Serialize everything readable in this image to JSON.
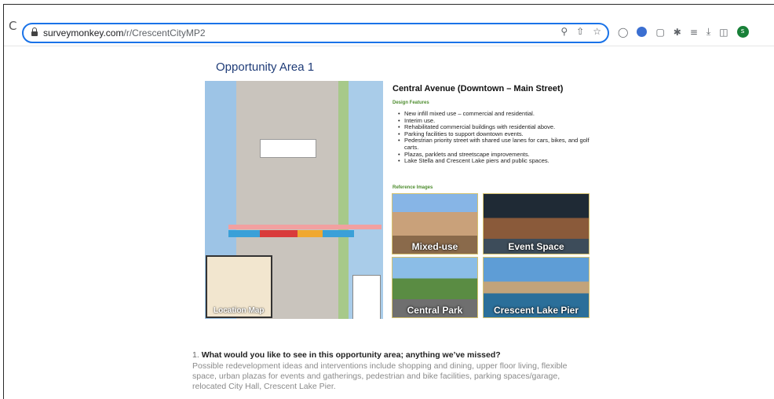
{
  "browser": {
    "reload_glyph": "C",
    "url_host": "surveymonkey.com",
    "url_path": "/r/CrescentCityMP2",
    "omnibox_icons": [
      "zoom-icon",
      "share-icon",
      "bookmark-star-icon"
    ],
    "extension_icons": [
      "extension-s-icon",
      "extension-circle-icon",
      "extension-square-icon",
      "extensions-puzzle-icon",
      "reading-list-icon",
      "download-icon",
      "side-panel-icon"
    ],
    "avatar_initial": "s",
    "avatar_color": "#188038",
    "focus_color": "#1a73e8"
  },
  "slide": {
    "title": "Opportunity Area 1",
    "map_caption": "Location Map",
    "heading": "Central Avenue (Downtown – Main Street)",
    "design_label": "Design Features",
    "features": [
      "New infill mixed use – commercial and residential.",
      "Interim use.",
      "Rehabilitated commercial buildings with residential above.",
      "Parking facilities to support downtown events.",
      "Pedestrian priority street with shared use lanes for cars, bikes, and golf carts.",
      "Plazas, parklets and streetscape improvements.",
      "Lake Stella and Crescent Lake piers and public spaces."
    ],
    "reference_label": "Reference Images",
    "references": [
      "Mixed-use",
      "Event Space",
      "Central Park",
      "Crescent Lake Pier"
    ]
  },
  "question": {
    "number": "1.",
    "text": "What would you like to see in this opportunity area; anything we’ve missed?",
    "description": "Possible redevelopment ideas and interventions  include shopping and dining, upper floor living, flexible space, urban plazas for events and gatherings, pedestrian and bike facilities, parking spaces/garage, relocated City Hall, Crescent Lake Pier."
  }
}
